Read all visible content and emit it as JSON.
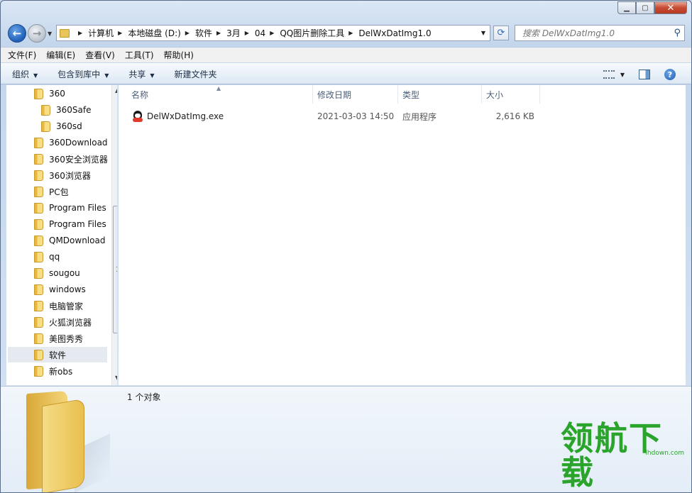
{
  "window": {
    "controls": {
      "minimize": "▁",
      "maximize": "▢",
      "close": "✕"
    }
  },
  "address": {
    "crumbs": [
      "计算机",
      "本地磁盘 (D:)",
      "软件",
      "3月",
      "04",
      "QQ图片删除工具",
      "DelWxDatImg1.0"
    ]
  },
  "search": {
    "placeholder": "搜索 DelWxDatImg1.0"
  },
  "menubar": [
    "文件(F)",
    "编辑(E)",
    "查看(V)",
    "工具(T)",
    "帮助(H)"
  ],
  "toolbar": {
    "organize": "组织",
    "include_in_library": "包含到库中",
    "share": "共享",
    "new_folder": "新建文件夹"
  },
  "tree": [
    {
      "label": "360",
      "indent": 0
    },
    {
      "label": "360Safe",
      "indent": 1
    },
    {
      "label": "360sd",
      "indent": 1
    },
    {
      "label": "360Download",
      "indent": 0
    },
    {
      "label": "360安全浏览器",
      "indent": 0
    },
    {
      "label": "360浏览器",
      "indent": 0
    },
    {
      "label": "PC包",
      "indent": 0
    },
    {
      "label": "Program Files",
      "indent": 0
    },
    {
      "label": "Program Files",
      "indent": 0
    },
    {
      "label": "QMDownload",
      "indent": 0
    },
    {
      "label": "qq",
      "indent": 0
    },
    {
      "label": "sougou",
      "indent": 0
    },
    {
      "label": "windows",
      "indent": 0
    },
    {
      "label": "电脑管家",
      "indent": 0
    },
    {
      "label": "火狐浏览器",
      "indent": 0
    },
    {
      "label": "美图秀秀",
      "indent": 0
    },
    {
      "label": "软件",
      "indent": 0,
      "selected": true
    },
    {
      "label": "新obs",
      "indent": 0
    }
  ],
  "columns": {
    "name": "名称",
    "modified": "修改日期",
    "type": "类型",
    "size": "大小"
  },
  "files": [
    {
      "name": "DelWxDatImg.exe",
      "modified": "2021-03-03 14:50",
      "type": "应用程序",
      "size": "2,616 KB"
    }
  ],
  "details": {
    "count": "1 个对象"
  },
  "watermark": {
    "text": "领航下载",
    "url": "lhdown.com"
  }
}
